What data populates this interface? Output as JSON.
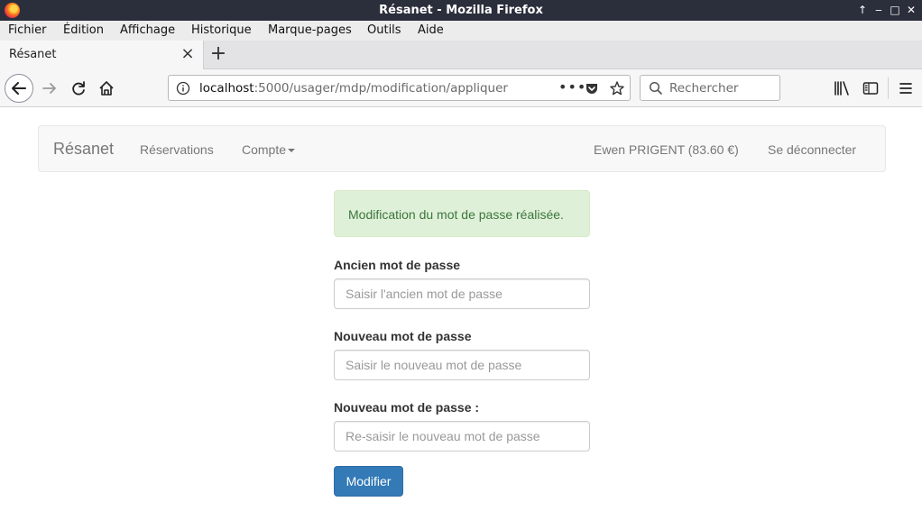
{
  "window": {
    "title": "Résanet - Mozilla Firefox"
  },
  "menubar": {
    "items": [
      "Fichier",
      "Édition",
      "Affichage",
      "Historique",
      "Marque-pages",
      "Outils",
      "Aide"
    ]
  },
  "tabs": [
    {
      "label": "Résanet"
    }
  ],
  "urlbar": {
    "host": "localhost",
    "rest": ":5000/usager/mdp/modification/appliquer"
  },
  "search": {
    "placeholder": "Rechercher"
  },
  "site_nav": {
    "brand": "Résanet",
    "reservations": "Réservations",
    "compte": "Compte",
    "user": "Ewen PRIGENT (83.60 €)",
    "logout": "Se déconnecter"
  },
  "alert": {
    "message": "Modification du mot de passe réalisée."
  },
  "form": {
    "old_label": "Ancien mot de passe",
    "old_placeholder": "Saisir l'ancien mot de passe",
    "new_label": "Nouveau mot de passe",
    "new_placeholder": "Saisir le nouveau mot de passe",
    "confirm_label": "Nouveau mot de passe :",
    "confirm_placeholder": "Re-saisir le nouveau mot de passe",
    "submit": "Modifier"
  },
  "colors": {
    "primary": "#337ab7",
    "alert_bg": "#dff0d8",
    "alert_text": "#3c763d",
    "titlebar": "#2b2e3b"
  }
}
